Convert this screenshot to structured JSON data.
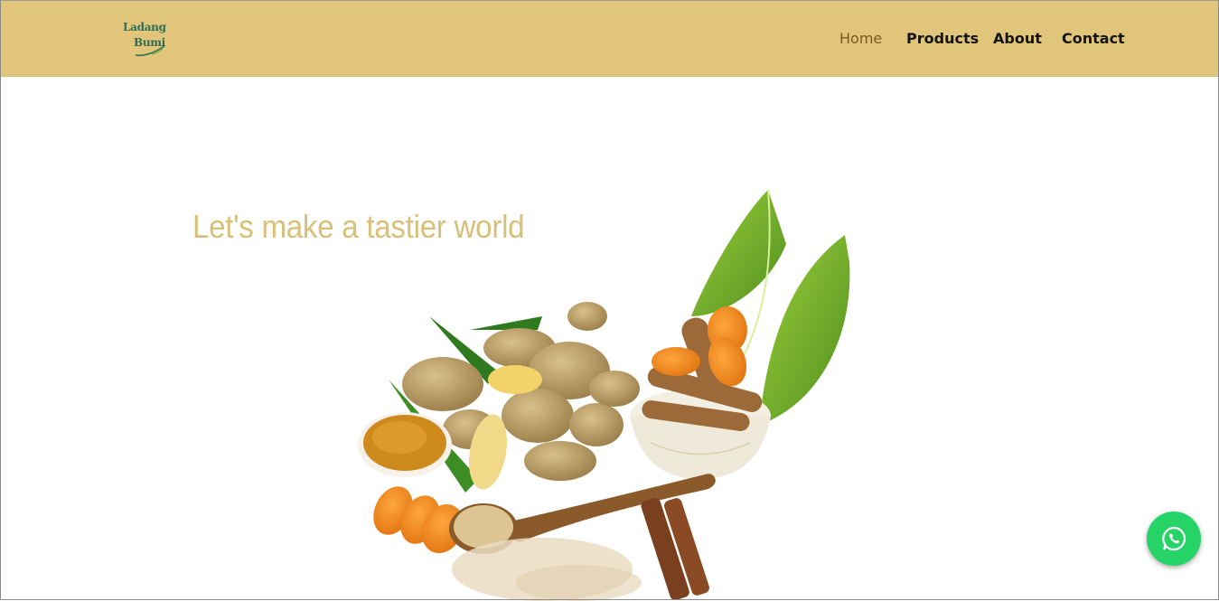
{
  "brand": {
    "line1": "Ladang",
    "line2": "Bumi",
    "logo_color": "#2f6d55"
  },
  "nav": {
    "items": [
      {
        "label": "Home",
        "active": true
      },
      {
        "label": "Products",
        "active": false
      },
      {
        "label": "About",
        "active": false
      },
      {
        "label": "Contact",
        "active": false
      }
    ]
  },
  "hero": {
    "title": "Let's make a tastier world",
    "image_icon": "spices-ginger-turmeric-cinnamon-image"
  },
  "whatsapp": {
    "icon": "whatsapp-icon",
    "color": "#25d366"
  },
  "colors": {
    "navbar_bg": "#e1c57a",
    "accent_text": "#d8bf7a",
    "active_link": "#7a5b16"
  }
}
